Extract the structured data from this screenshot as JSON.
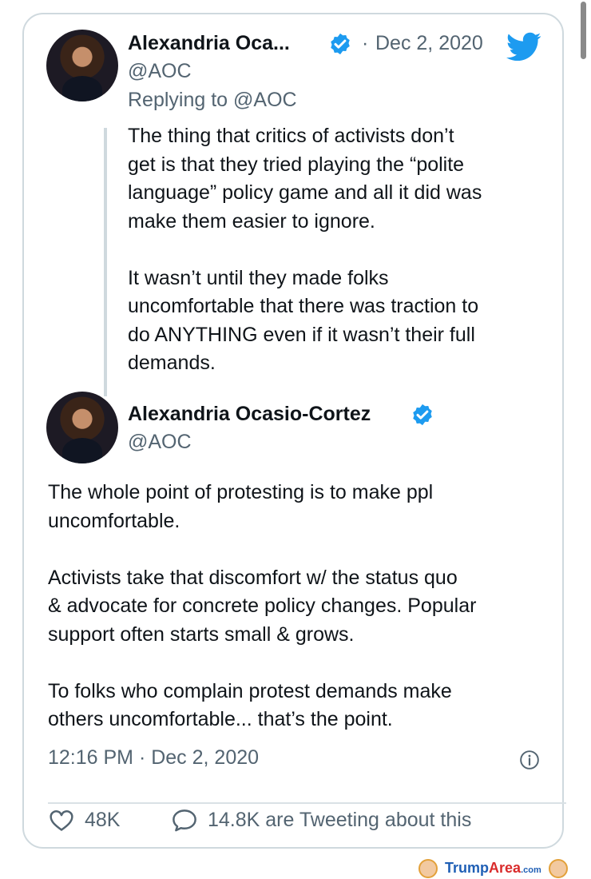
{
  "first_tweet": {
    "name": "Alexandria Oca...",
    "handle": "@AOC",
    "date": "Dec 2, 2020",
    "reply_context": "Replying to @AOC",
    "text": "The thing that critics of activists don’t\nget is that they tried playing the “polite\nlanguage” policy game and all it did was\nmake them easier to ignore.\n\nIt wasn’t until they made folks\nuncomfortable that there was traction to\ndo ANYTHING even if it wasn’t their full\ndemands."
  },
  "main_tweet": {
    "name": "Alexandria Ocasio-Cortez",
    "handle": "@AOC",
    "text": "The whole point of protesting is to make ppl\nuncomfortable.\n\nActivists take that discomfort w/ the status quo\n& advocate for concrete policy changes. Popular\nsupport often starts small & grows.\n\nTo folks who complain protest demands make\nothers uncomfortable... that’s the point.",
    "timestamp": "12:16 PM · Dec 2, 2020",
    "like_count": "48K",
    "tweeting_text": "14.8K are Tweeting about this"
  },
  "footer": {
    "brand_main": "Trump",
    "brand_accent": "Area",
    "brand_suffix": ".com"
  },
  "colors": {
    "twitter_blue": "#1d9bf0",
    "text_gray": "#536471",
    "border": "#cfd9de"
  },
  "icons": [
    "twitter-bird-icon",
    "verified-badge-icon",
    "info-icon",
    "heart-icon",
    "reply-bubble-icon"
  ]
}
